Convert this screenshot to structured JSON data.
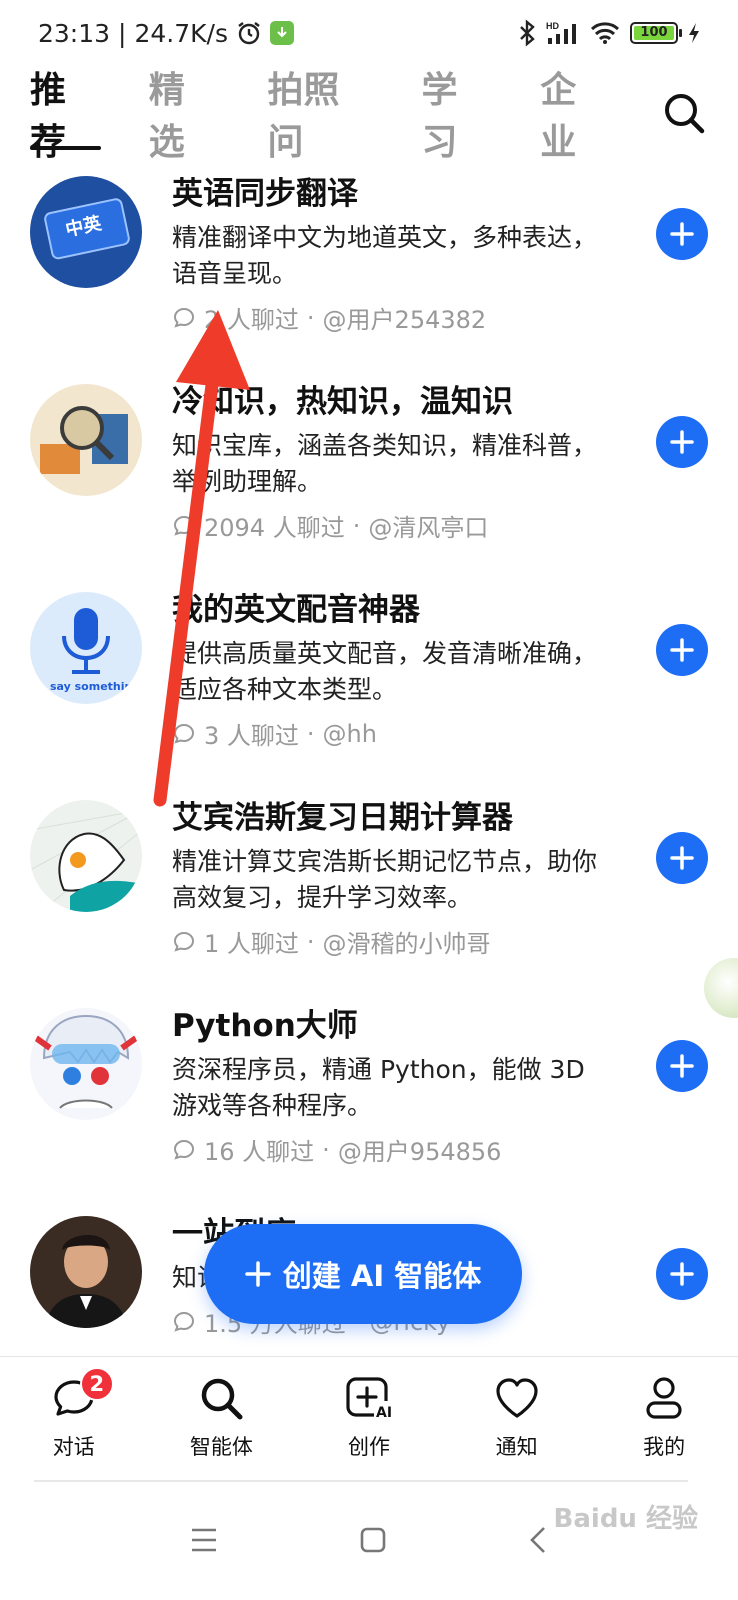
{
  "status_bar": {
    "time": "23:13",
    "net_speed": "24.7K/s",
    "battery": "100"
  },
  "tabs": [
    {
      "label": "推荐",
      "active": true
    },
    {
      "label": "精选",
      "active": false
    },
    {
      "label": "拍照问",
      "active": false
    },
    {
      "label": "学习",
      "active": false
    },
    {
      "label": "企业",
      "active": false
    }
  ],
  "agents": [
    {
      "title": "英语同步翻译",
      "desc": "精准翻译中文为地道英文，多种表达，语音呈现。",
      "chats": "2 人聊过",
      "author": "@用户254382",
      "avatar": "translate-avatar"
    },
    {
      "title": "冷知识，热知识，温知识",
      "desc": "知识宝库，涵盖各类知识，精准科普，举例助理解。",
      "chats": "2094 人聊过",
      "author": "@清风亭口",
      "avatar": "knowledge-avatar"
    },
    {
      "title": "我的英文配音神器",
      "desc": "提供高质量英文配音，发音清晰准确，适应各种文本类型。",
      "chats": "3 人聊过",
      "author": "@hh",
      "avatar": "microphone-avatar",
      "avatar_text": "say something"
    },
    {
      "title": "艾宾浩斯复习日期计算器",
      "desc": "精准计算艾宾浩斯长期记忆节点，助你高效复习，提升学习效率。",
      "chats": "1 人聊过",
      "author": "@滑稽的小帅哥",
      "avatar": "abstract-avatar"
    },
    {
      "title": "Python大师",
      "desc": "资深程序员，精通 Python，能做 3D 游戏等各种程序。",
      "chats": "16 人聊过",
      "author": "@用户954856",
      "avatar": "anime-boy-avatar"
    },
    {
      "title": "一站到底",
      "desc": "知识……题挑战你，",
      "chats": "1.5 万人聊过",
      "author": "@ricky",
      "avatar": "man-portrait-avatar"
    }
  ],
  "create_button": {
    "label": "创建 AI 智能体"
  },
  "bottom_nav": [
    {
      "label": "对话",
      "icon": "chat-icon",
      "badge": "2"
    },
    {
      "label": "智能体",
      "icon": "search-icon"
    },
    {
      "label": "创作",
      "icon": "create-ai-icon",
      "icon_text": "AI"
    },
    {
      "label": "通知",
      "icon": "heart-icon"
    },
    {
      "label": "我的",
      "icon": "profile-icon"
    }
  ],
  "watermark": "Baidu 经验"
}
